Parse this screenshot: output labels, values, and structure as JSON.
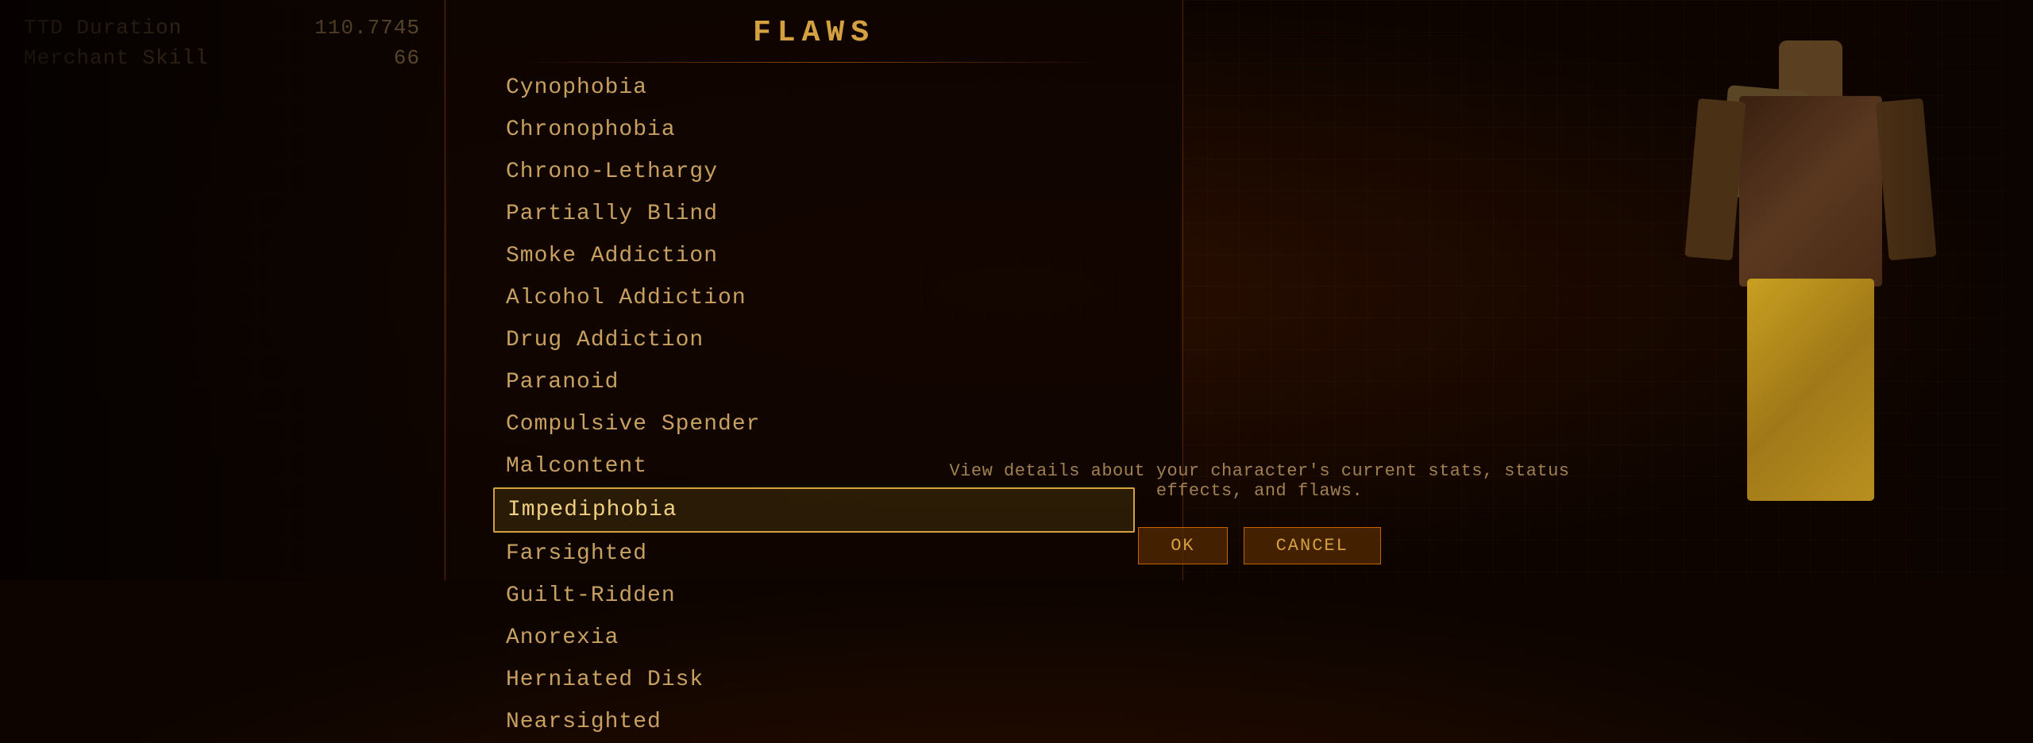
{
  "left_panel": {
    "stats": [
      {
        "label": "TTD Duration",
        "value": "110.7745"
      },
      {
        "label": "Merchant Skill",
        "value": "66"
      }
    ]
  },
  "center_panel": {
    "title": "FLAWS",
    "flaws": [
      {
        "id": 1,
        "label": "Cynophobia",
        "selected": false
      },
      {
        "id": 2,
        "label": "Chronophobia",
        "selected": false
      },
      {
        "id": 3,
        "label": "Chrono-Lethargy",
        "selected": false
      },
      {
        "id": 4,
        "label": "Partially Blind",
        "selected": false
      },
      {
        "id": 5,
        "label": "Smoke Addiction",
        "selected": false
      },
      {
        "id": 6,
        "label": "Alcohol Addiction",
        "selected": false
      },
      {
        "id": 7,
        "label": "Drug Addiction",
        "selected": false
      },
      {
        "id": 8,
        "label": "Paranoid",
        "selected": false
      },
      {
        "id": 9,
        "label": "Compulsive Spender",
        "selected": false
      },
      {
        "id": 10,
        "label": "Malcontent",
        "selected": false
      },
      {
        "id": 11,
        "label": "Impediphobia",
        "selected": true
      },
      {
        "id": 12,
        "label": "Farsighted",
        "selected": false
      },
      {
        "id": 13,
        "label": "Guilt-Ridden",
        "selected": false
      },
      {
        "id": 14,
        "label": "Anorexia",
        "selected": false
      },
      {
        "id": 15,
        "label": "Herniated Disk",
        "selected": false
      },
      {
        "id": 16,
        "label": "Nearsighted",
        "selected": false
      }
    ],
    "status_text": "View details about your character's current stats, status effects, and flaws.",
    "buttons": [
      {
        "label": "OK"
      },
      {
        "label": "CANCEL"
      }
    ]
  }
}
